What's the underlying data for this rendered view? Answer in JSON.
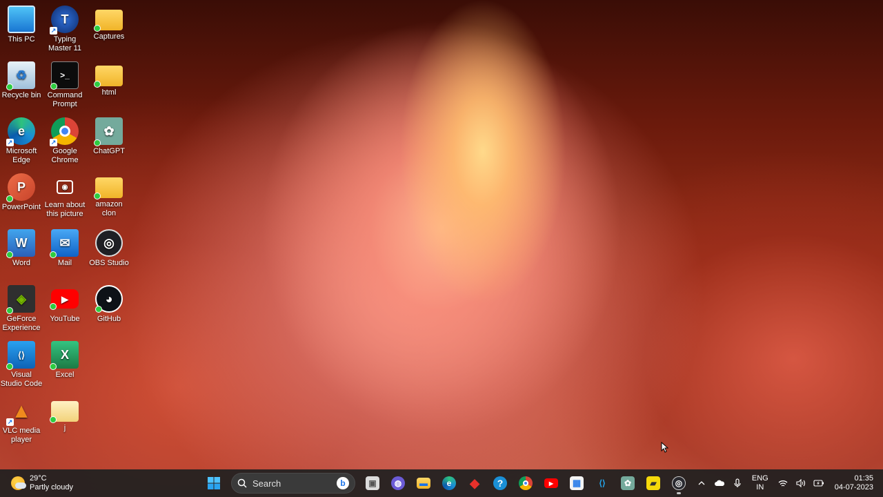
{
  "desktop": {
    "icons": [
      {
        "label": "This PC",
        "glyph": "▭",
        "color": "#3aa0e0"
      },
      {
        "label": "Typing Master 11",
        "glyph": "T",
        "color": "#1b3f8f"
      },
      {
        "label": "Captures",
        "glyph": "",
        "color": "#f2c744"
      },
      {
        "label": "Recycle bin",
        "glyph": "♻",
        "color": "#7fa8c9"
      },
      {
        "label": "Command Prompt",
        "glyph": ">_",
        "color": "#111111"
      },
      {
        "label": "html",
        "glyph": "",
        "color": "#f2c744"
      },
      {
        "label": "Microsoft Edge",
        "glyph": "e",
        "color": "#1a8fd6"
      },
      {
        "label": "Google Chrome",
        "glyph": "●",
        "color": "#db4437"
      },
      {
        "label": "ChatGPT",
        "glyph": "✿",
        "color": "#74aa9c"
      },
      {
        "label": "PowerPoint",
        "glyph": "P",
        "color": "#c8442b"
      },
      {
        "label": "Learn about this picture",
        "glyph": "◉",
        "color": "#2b2b2b"
      },
      {
        "label": "amazon clon",
        "glyph": "",
        "color": "#f2c744"
      },
      {
        "label": "Word",
        "glyph": "W",
        "color": "#2b5fb8"
      },
      {
        "label": "Mail",
        "glyph": "✉",
        "color": "#1e7fd8"
      },
      {
        "label": "OBS Studio",
        "glyph": "◎",
        "color": "#1f1f24"
      },
      {
        "label": "GeForce Experience",
        "glyph": "◈",
        "color": "#2f2f2f"
      },
      {
        "label": "YouTube",
        "glyph": "▶",
        "color": "#ff0000"
      },
      {
        "label": "GitHub",
        "glyph": "◕",
        "color": "#1b1f23"
      },
      {
        "label": "Visual Studio Code",
        "glyph": "⟨⟩",
        "color": "#1f8ad2"
      },
      {
        "label": "Excel",
        "glyph": "X",
        "color": "#1d7a44"
      },
      {
        "label": "VLC media player",
        "glyph": "▲",
        "color": "#f08b1d"
      },
      {
        "label": "j",
        "glyph": "",
        "color": "#f2d27a"
      }
    ]
  },
  "taskbar": {
    "weather": {
      "temp": "29°C",
      "condition": "Partly cloudy"
    },
    "search_placeholder": "Search",
    "search_bing": "b",
    "apps": [
      {
        "name": "task-view",
        "glyph": "▣",
        "color": "#8a8a8a"
      },
      {
        "name": "teams-chat",
        "glyph": "◍",
        "color": "#6b5bd6"
      },
      {
        "name": "file-explorer",
        "glyph": "▬",
        "color": "#f2c744"
      },
      {
        "name": "edge",
        "glyph": "e",
        "color": "#1a8fd6"
      },
      {
        "name": "anydesk",
        "glyph": "◆",
        "color": "#e8312b"
      },
      {
        "name": "help",
        "glyph": "?",
        "color": "#1a8fd6"
      },
      {
        "name": "chrome",
        "glyph": "●",
        "color": "#db4437"
      },
      {
        "name": "youtube",
        "glyph": "▶",
        "color": "#ff0000"
      },
      {
        "name": "store",
        "glyph": "▦",
        "color": "#2b7de9"
      },
      {
        "name": "vscode",
        "glyph": "⟨⟩",
        "color": "#1f8ad2"
      },
      {
        "name": "chatgpt",
        "glyph": "✿",
        "color": "#74aa9c"
      },
      {
        "name": "sticky-notes",
        "glyph": "▰",
        "color": "#f5d90a"
      },
      {
        "name": "obs",
        "glyph": "◎",
        "color": "#2a2a30"
      }
    ],
    "tray": {
      "chevron": "^",
      "language_top": "ENG",
      "language_bottom": "IN",
      "time": "01:35",
      "date": "04-07-2023"
    }
  }
}
